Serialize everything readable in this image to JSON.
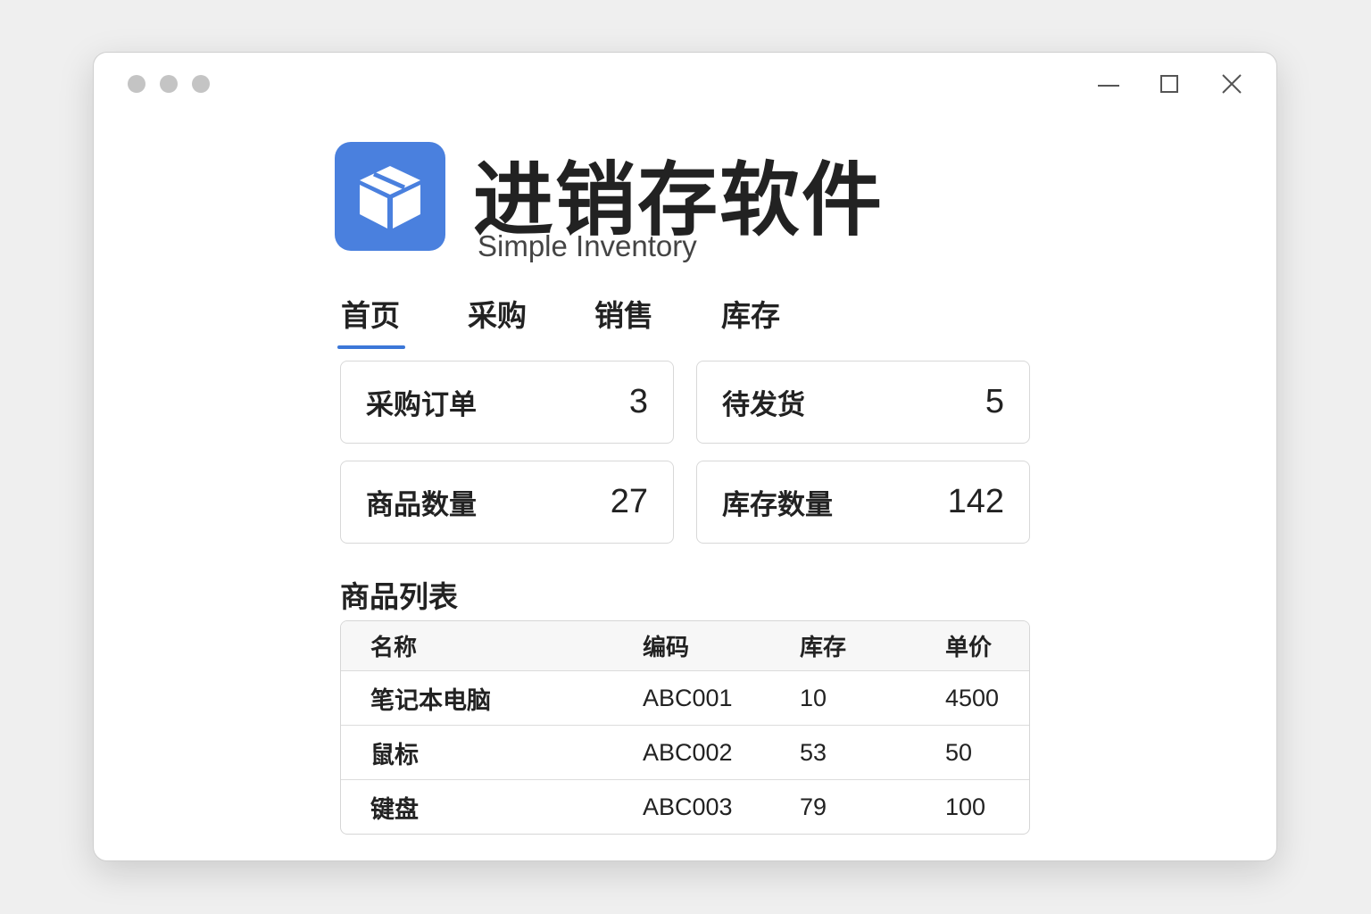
{
  "window": {
    "controls": [
      "minimize-icon",
      "maximize-icon",
      "close-icon"
    ]
  },
  "app": {
    "title": "进销存软件",
    "subtitle": "Simple Inventory",
    "logo_icon": "package-box-icon",
    "accent": "#4a80de"
  },
  "tabs": [
    {
      "label": "首页",
      "active": true
    },
    {
      "label": "采购"
    },
    {
      "label": "销售"
    },
    {
      "label": "库存"
    }
  ],
  "stats": [
    {
      "label": "采购订单",
      "value": "3"
    },
    {
      "label": "待发货",
      "value": "5"
    },
    {
      "label": "商品数量",
      "value": "27"
    },
    {
      "label": "库存数量",
      "value": "142"
    }
  ],
  "product_list": {
    "title": "商品列表",
    "columns": [
      "名称",
      "编码",
      "库存",
      "单价"
    ],
    "rows": [
      [
        "笔记本电脑",
        "ABC001",
        "10",
        "4500"
      ],
      [
        "鼠标",
        "ABC002",
        "53",
        "50"
      ],
      [
        "键盘",
        "ABC003",
        "79",
        "100"
      ]
    ]
  }
}
